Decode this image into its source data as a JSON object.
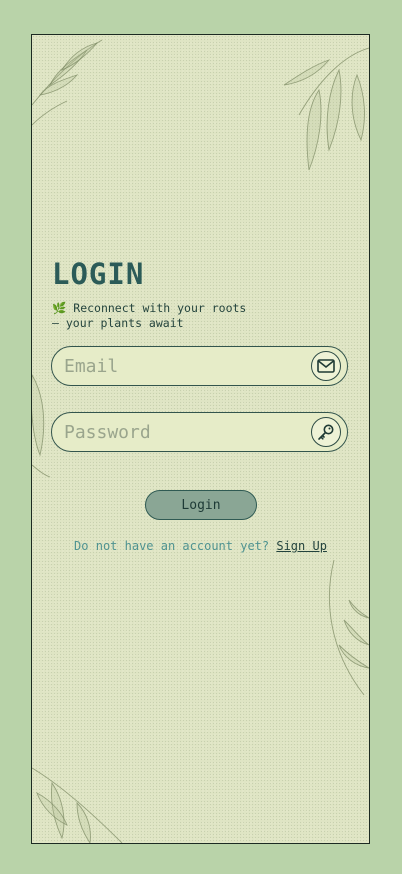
{
  "login": {
    "title": "LOGIN",
    "subtitle_icon": "sprout-icon",
    "subtitle_icon_glyph": "🌿",
    "subtitle_line1": "Reconnect with your roots",
    "subtitle_line2": "— your plants await"
  },
  "email": {
    "placeholder": "Email",
    "icon": "mail-icon"
  },
  "password": {
    "placeholder": "Password",
    "icon": "key-icon"
  },
  "login_button": {
    "label": "Login"
  },
  "signup": {
    "prompt": "Do not have an account yet?",
    "link": "Sign Up"
  },
  "colors": {
    "background": "#b9d3a9",
    "panel": "#dfe5c4",
    "title": "#2b5b58",
    "button": "#8aa695",
    "link_prompt": "#4f9391"
  }
}
